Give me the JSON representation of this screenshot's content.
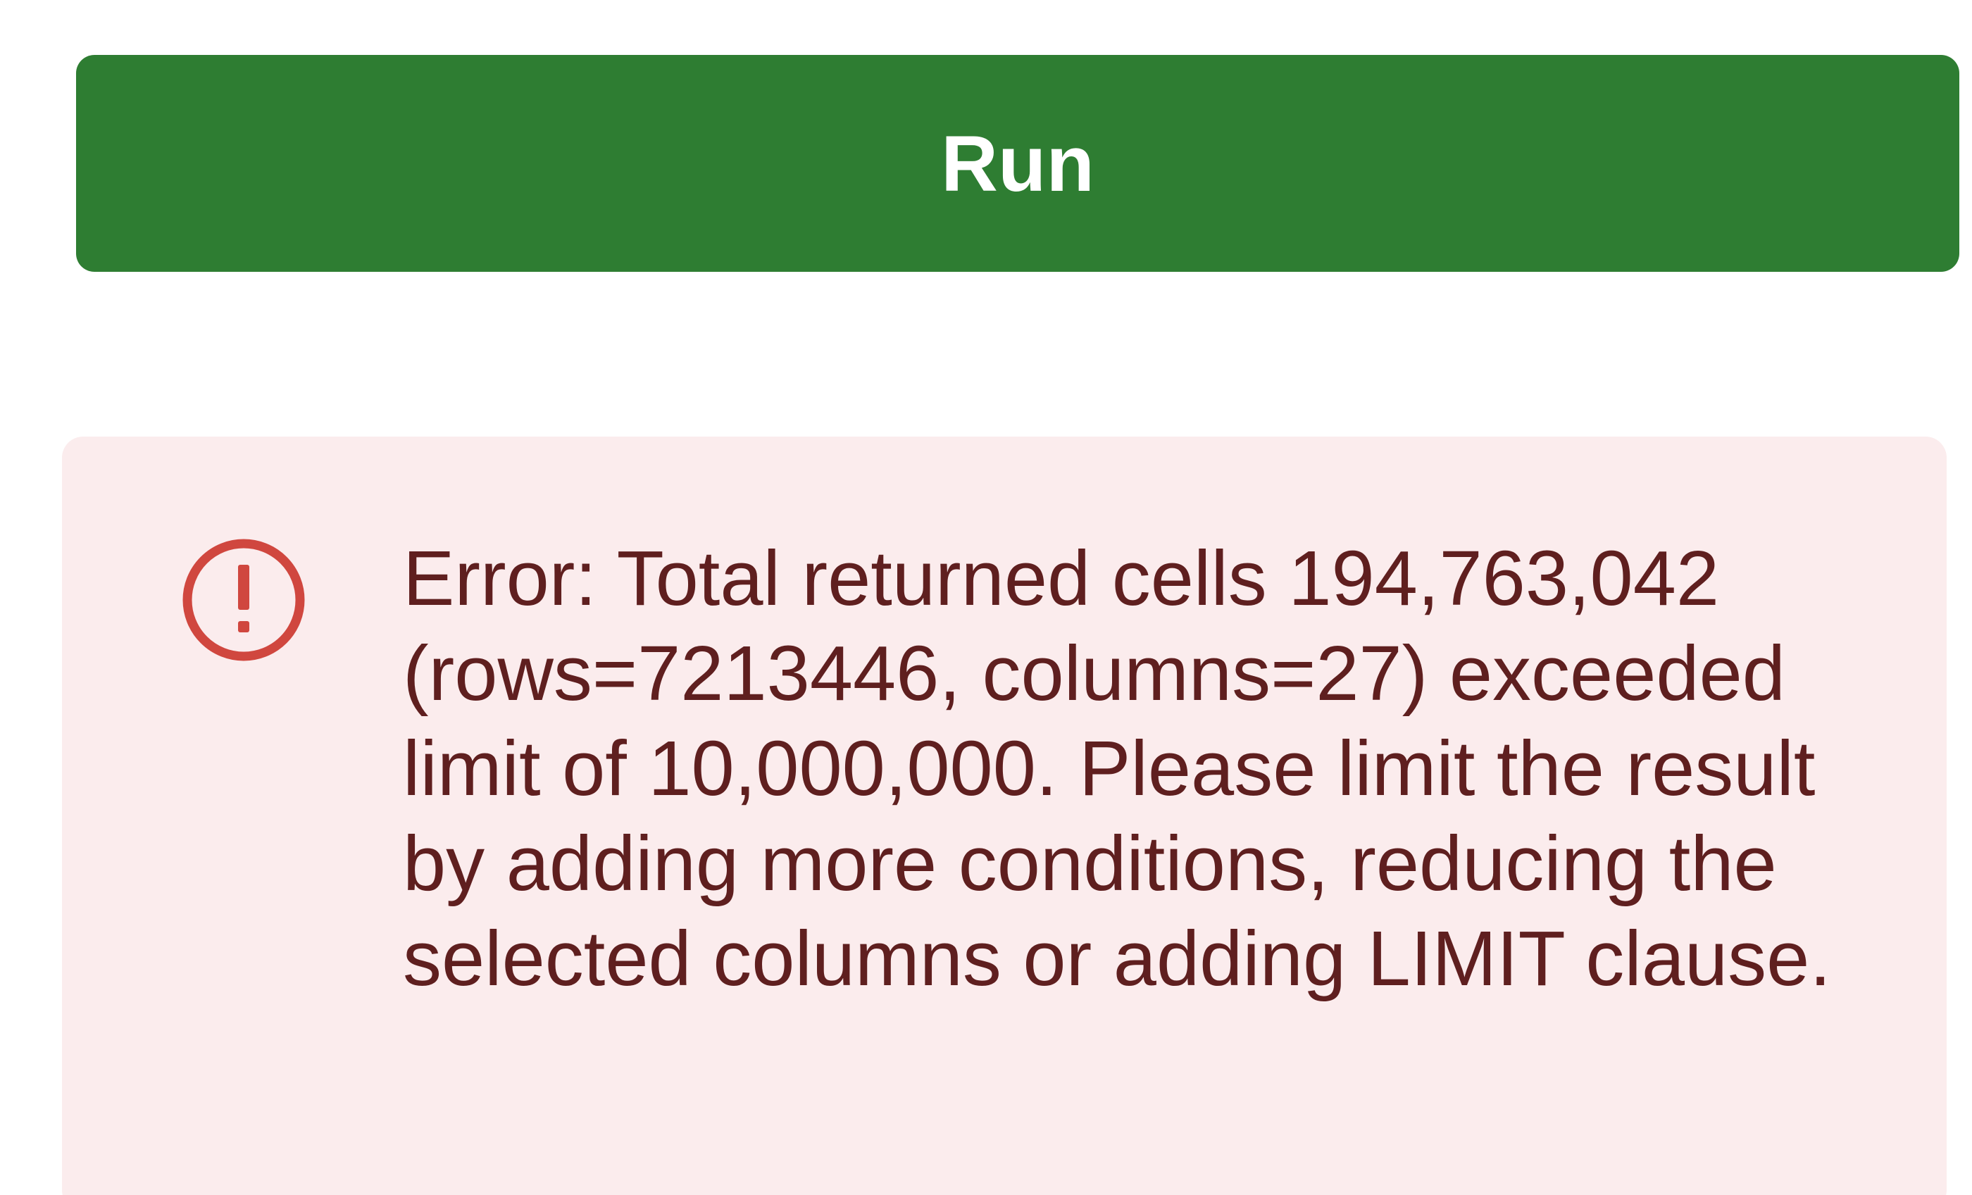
{
  "run_button": {
    "label": "Run"
  },
  "error": {
    "icon": "error-exclamation-circle-icon",
    "message": "Error: Total returned cells 194,763,042 (rows=7213446, columns=27) exceeded limit of 10,000,000. Please limit the result by adding more conditions, reducing the selected columns or adding LIMIT clause."
  },
  "colors": {
    "run_button_bg": "#2e7d32",
    "run_button_text": "#ffffff",
    "error_panel_bg": "#fbeced",
    "error_text": "#5f1f1f",
    "error_icon": "#d0473f"
  }
}
